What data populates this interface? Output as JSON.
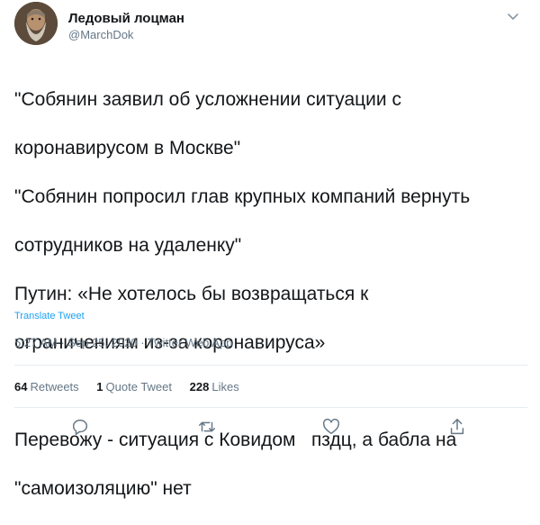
{
  "author": {
    "display_name": "Ледовый лоцман",
    "handle": "@MarchDok"
  },
  "tweet": {
    "lines": [
      "\"Собянин заявил об усложнении ситуации с",
      "коронавирусом в Москве\"",
      "\"Собянин попросил глав крупных компаний вернуть",
      "сотрудников на удаленку\"",
      "Путин: «Не хотелось бы возвращаться к",
      "ограничениям из-за коронавируса»",
      "",
      "Перевожу - ситуация с Ковидом   пздц, а бабла на",
      "\"самоизоляцию\" нет"
    ],
    "translate_label": "Translate Tweet"
  },
  "meta": {
    "time": "5:27 AM",
    "date": "Sep 25, 2020",
    "source": "Twitter Web App",
    "separator": "·"
  },
  "stats": {
    "retweets_count": "64",
    "retweets_label": "Retweets",
    "quotes_count": "1",
    "quotes_label": "Quote Tweet",
    "likes_count": "228",
    "likes_label": "Likes"
  },
  "icons": {
    "caret": "chevron-down-icon",
    "reply": "reply-icon",
    "retweet": "retweet-icon",
    "like": "heart-icon",
    "share": "share-icon"
  },
  "colors": {
    "text": "#14171a",
    "secondary": "#657786",
    "link": "#1da1f2",
    "divider": "#e6ecf0"
  }
}
